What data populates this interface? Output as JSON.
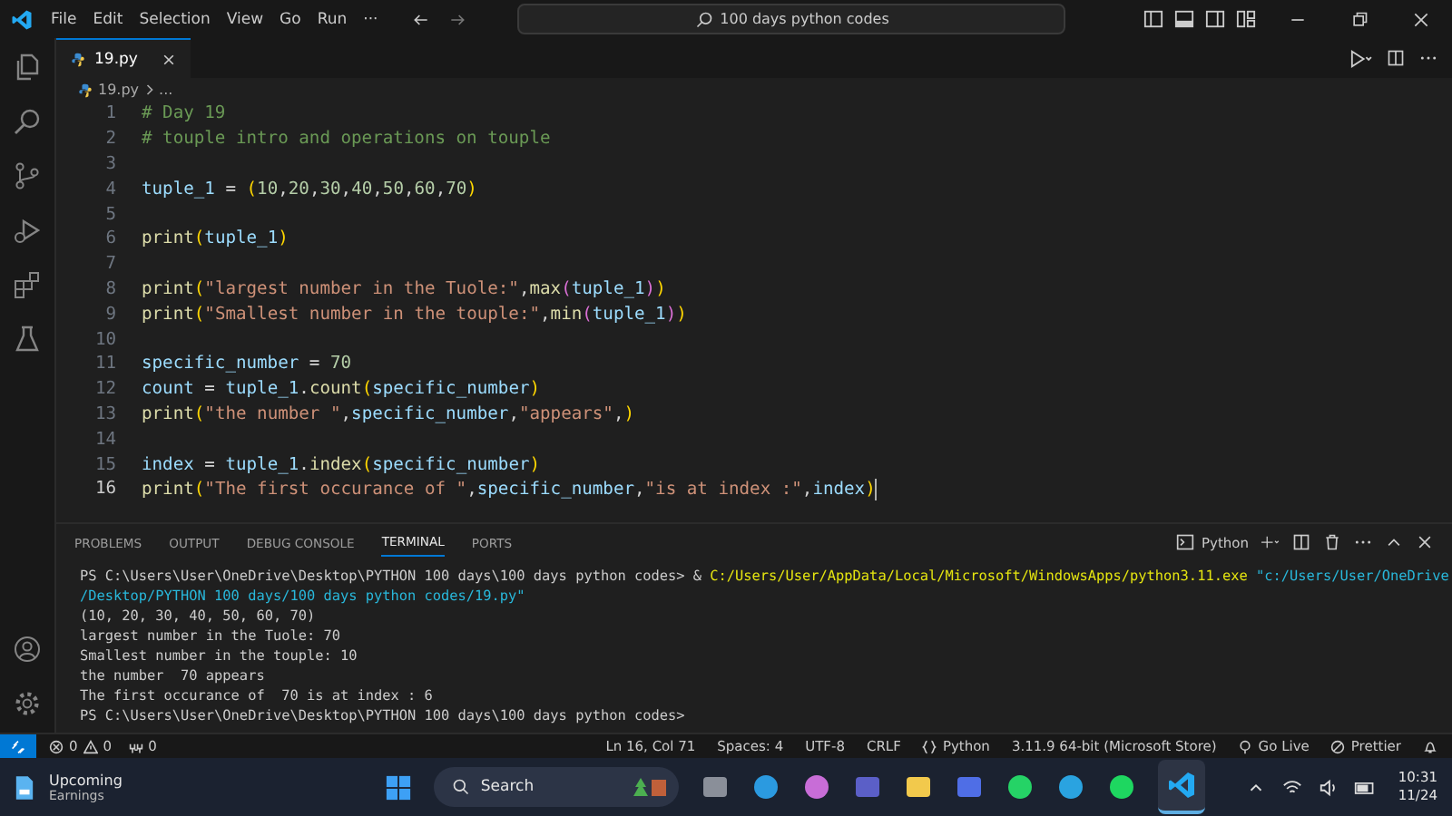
{
  "title_bar": {
    "menu": [
      "File",
      "Edit",
      "Selection",
      "View",
      "Go",
      "Run",
      "···"
    ],
    "search": "100 days python codes"
  },
  "tabs": [
    {
      "label": "19.py",
      "selected": true
    }
  ],
  "breadcrumb": [
    "19.py",
    "..."
  ],
  "editor": {
    "lines": [
      {
        "number": "1",
        "active": false,
        "tokens": [
          {
            "text": "# Day 19",
            "kind": "comment"
          }
        ]
      },
      {
        "number": "2",
        "active": false,
        "tokens": [
          {
            "text": "# touple intro and operations on touple",
            "kind": "comment"
          }
        ]
      },
      {
        "number": "3",
        "active": false
      },
      {
        "number": "4",
        "active": false,
        "tokens": [
          {
            "text": "tuple_1",
            "kind": "var"
          },
          {
            "text": " = ",
            "kind": "op"
          },
          {
            "text": "(",
            "kind": "b1"
          },
          {
            "text": "10",
            "kind": "num"
          },
          {
            "text": ",",
            "kind": "op"
          },
          {
            "text": "20",
            "kind": "num"
          },
          {
            "text": ",",
            "kind": "op"
          },
          {
            "text": "30",
            "kind": "num"
          },
          {
            "text": ",",
            "kind": "op"
          },
          {
            "text": "40",
            "kind": "num"
          },
          {
            "text": ",",
            "kind": "op"
          },
          {
            "text": "50",
            "kind": "num"
          },
          {
            "text": ",",
            "kind": "op"
          },
          {
            "text": "60",
            "kind": "num"
          },
          {
            "text": ",",
            "kind": "op"
          },
          {
            "text": "70",
            "kind": "num"
          },
          {
            "text": ")",
            "kind": "b1"
          }
        ]
      },
      {
        "number": "5",
        "active": false
      },
      {
        "number": "6",
        "active": false,
        "tokens": [
          {
            "text": "print",
            "kind": "fn"
          },
          {
            "text": "(",
            "kind": "b1"
          },
          {
            "text": "tuple_1",
            "kind": "var"
          },
          {
            "text": ")",
            "kind": "b1"
          }
        ]
      },
      {
        "number": "7",
        "active": false
      },
      {
        "number": "8",
        "active": false,
        "tokens": [
          {
            "text": "print",
            "kind": "fn"
          },
          {
            "text": "(",
            "kind": "b1"
          },
          {
            "text": "\"largest number in the Tuole:\"",
            "kind": "str"
          },
          {
            "text": ",",
            "kind": "op"
          },
          {
            "text": "max",
            "kind": "fn"
          },
          {
            "text": "(",
            "kind": "b2"
          },
          {
            "text": "tuple_1",
            "kind": "var"
          },
          {
            "text": ")",
            "kind": "b2"
          },
          {
            "text": ")",
            "kind": "b1"
          }
        ]
      },
      {
        "number": "9",
        "active": false,
        "tokens": [
          {
            "text": "print",
            "kind": "fn"
          },
          {
            "text": "(",
            "kind": "b1"
          },
          {
            "text": "\"Smallest number in the touple:\"",
            "kind": "str"
          },
          {
            "text": ",",
            "kind": "op"
          },
          {
            "text": "min",
            "kind": "fn"
          },
          {
            "text": "(",
            "kind": "b2"
          },
          {
            "text": "tuple_1",
            "kind": "var"
          },
          {
            "text": ")",
            "kind": "b2"
          },
          {
            "text": ")",
            "kind": "b1"
          }
        ]
      },
      {
        "number": "10",
        "active": false
      },
      {
        "number": "11",
        "active": false,
        "tokens": [
          {
            "text": "specific_number",
            "kind": "var"
          },
          {
            "text": " = ",
            "kind": "op"
          },
          {
            "text": "70",
            "kind": "num"
          }
        ]
      },
      {
        "number": "12",
        "active": false,
        "tokens": [
          {
            "text": "count",
            "kind": "var"
          },
          {
            "text": " = ",
            "kind": "op"
          },
          {
            "text": "tuple_1",
            "kind": "var"
          },
          {
            "text": ".",
            "kind": "op"
          },
          {
            "text": "count",
            "kind": "fn"
          },
          {
            "text": "(",
            "kind": "b1"
          },
          {
            "text": "specific_number",
            "kind": "var"
          },
          {
            "text": ")",
            "kind": "b1"
          }
        ]
      },
      {
        "number": "13",
        "active": false,
        "tokens": [
          {
            "text": "print",
            "kind": "fn"
          },
          {
            "text": "(",
            "kind": "b1"
          },
          {
            "text": "\"the number \"",
            "kind": "str"
          },
          {
            "text": ",",
            "kind": "op"
          },
          {
            "text": "specific_number",
            "kind": "var"
          },
          {
            "text": ",",
            "kind": "op"
          },
          {
            "text": "\"appears\"",
            "kind": "str"
          },
          {
            "text": ",",
            "kind": "op"
          },
          {
            "text": ")",
            "kind": "b1"
          }
        ]
      },
      {
        "number": "14",
        "active": false
      },
      {
        "number": "15",
        "active": false,
        "tokens": [
          {
            "text": "index",
            "kind": "var"
          },
          {
            "text": " = ",
            "kind": "op"
          },
          {
            "text": "tuple_1",
            "kind": "var"
          },
          {
            "text": ".",
            "kind": "op"
          },
          {
            "text": "index",
            "kind": "fn"
          },
          {
            "text": "(",
            "kind": "b1"
          },
          {
            "text": "specific_number",
            "kind": "var"
          },
          {
            "text": ")",
            "kind": "b1"
          }
        ]
      },
      {
        "number": "16",
        "active": true,
        "tokens": [
          {
            "text": "print",
            "kind": "fn"
          },
          {
            "text": "(",
            "kind": "b1"
          },
          {
            "text": "\"The first occurance of \"",
            "kind": "str"
          },
          {
            "text": ",",
            "kind": "op"
          },
          {
            "text": "specific_number",
            "kind": "var"
          },
          {
            "text": ",",
            "kind": "op"
          },
          {
            "text": "\"is at index :\"",
            "kind": "str"
          },
          {
            "text": ",",
            "kind": "op"
          },
          {
            "text": "index",
            "kind": "var"
          },
          {
            "text": ")",
            "kind": "b1"
          }
        ]
      }
    ]
  },
  "panel": {
    "tabs": [
      {
        "label": "PROBLEMS",
        "selected": false
      },
      {
        "label": "OUTPUT",
        "selected": false
      },
      {
        "label": "DEBUG CONSOLE",
        "selected": false
      },
      {
        "label": "TERMINAL",
        "selected": true
      },
      {
        "label": "PORTS",
        "selected": false
      }
    ],
    "terminal_name": "Python",
    "lines": [
      [
        {
          "text": "PS C:\\Users\\User\\OneDrive\\Desktop\\PYTHON 100 days\\100 days python codes> & ",
          "kind": "plain"
        },
        {
          "text": "C:/Users/User/AppData/Local/Microsoft/WindowsApps/python3.11.exe ",
          "kind": "path"
        },
        {
          "text": "\"c:/Users/User/OneDrive",
          "kind": "str"
        }
      ],
      [
        {
          "text": "/Desktop/PYTHON 100 days/100 days python codes/19.py\"",
          "kind": "str"
        }
      ],
      [
        {
          "text": "(10, 20, 30, 40, 50, 60, 70)",
          "kind": "plain"
        }
      ],
      [
        {
          "text": "largest number in the Tuole: 70",
          "kind": "plain"
        }
      ],
      [
        {
          "text": "Smallest number in the touple: 10",
          "kind": "plain"
        }
      ],
      [
        {
          "text": "the number  70 appears",
          "kind": "plain"
        }
      ],
      [
        {
          "text": "The first occurance of  70 is at index : 6",
          "kind": "plain"
        }
      ],
      [
        {
          "text": "PS C:\\Users\\User\\OneDrive\\Desktop\\PYTHON 100 days\\100 days python codes>",
          "kind": "plain"
        }
      ]
    ]
  },
  "status_bar": {
    "errors": "0",
    "warnings": "0",
    "ports": "0",
    "right": [
      {
        "kind": "text",
        "label": "Ln 16, Col 71"
      },
      {
        "kind": "text",
        "label": "Spaces: 4"
      },
      {
        "kind": "text",
        "label": "UTF-8"
      },
      {
        "kind": "text",
        "label": "CRLF"
      },
      {
        "kind": "braces",
        "label": "Python"
      },
      {
        "kind": "text",
        "label": "3.11.9 64-bit (Microsoft Store)"
      },
      {
        "kind": "live",
        "label": "Go Live"
      },
      {
        "kind": "prettier",
        "label": "Prettier"
      },
      {
        "kind": "bell"
      }
    ]
  },
  "taskbar": {
    "widget": [
      "Upcoming",
      "Earnings"
    ],
    "search": "Search",
    "time": "10:31",
    "date": "11/24"
  }
}
